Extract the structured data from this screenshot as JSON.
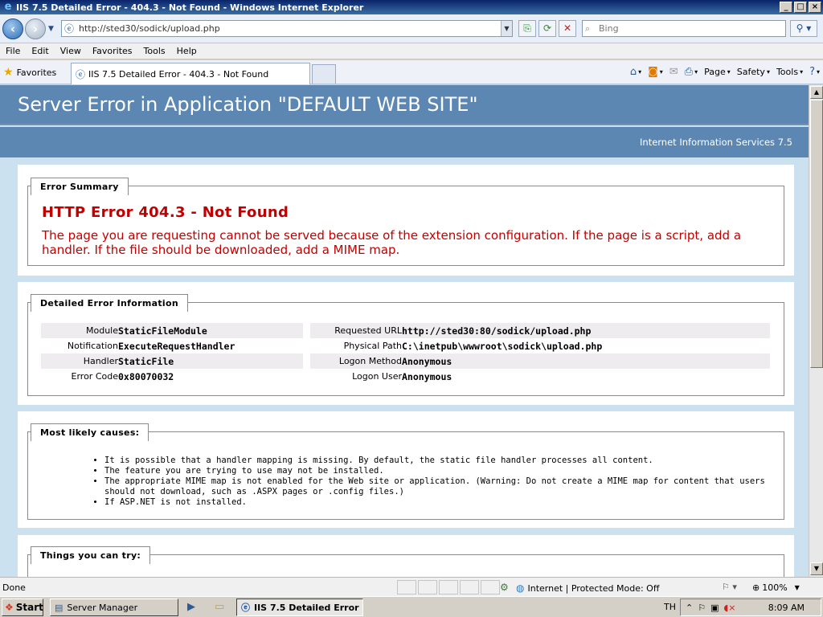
{
  "window": {
    "title": "IIS 7.5 Detailed Error - 404.3 - Not Found - Windows Internet Explorer"
  },
  "address": {
    "url": "http://sted30/sodick/upload.php",
    "search_placeholder": "Bing"
  },
  "menu": [
    "File",
    "Edit",
    "View",
    "Favorites",
    "Tools",
    "Help"
  ],
  "favorites": {
    "label": "Favorites",
    "tab_title": "IIS 7.5 Detailed Error - 404.3 - Not Found",
    "commands": {
      "page": "Page",
      "safety": "Safety",
      "tools": "Tools"
    }
  },
  "page": {
    "header_title": "Server Error in Application \"DEFAULT WEB SITE\"",
    "server_name": "Internet Information Services 7.5",
    "summary": {
      "legend": "Error Summary",
      "title": "HTTP Error 404.3 - Not Found",
      "description": "The page you are requesting cannot be served because of the extension configuration. If the page is a script, add a handler. If the file should be downloaded, add a MIME map."
    },
    "detail": {
      "legend": "Detailed Error Information",
      "left": [
        {
          "label": "Module",
          "value": "StaticFileModule"
        },
        {
          "label": "Notification",
          "value": "ExecuteRequestHandler"
        },
        {
          "label": "Handler",
          "value": "StaticFile"
        },
        {
          "label": "Error Code",
          "value": "0x80070032"
        }
      ],
      "right": [
        {
          "label": "Requested URL",
          "value": "http://sted30:80/sodick/upload.php"
        },
        {
          "label": "Physical Path",
          "value": "C:\\inetpub\\wwwroot\\sodick\\upload.php"
        },
        {
          "label": "Logon Method",
          "value": "Anonymous"
        },
        {
          "label": "Logon User",
          "value": "Anonymous"
        }
      ]
    },
    "causes": {
      "legend": "Most likely causes:",
      "items": [
        "It is possible that a handler mapping is missing. By default, the static file handler processes all content.",
        "The feature you are trying to use may not be installed.",
        "The appropriate MIME map is not enabled for the Web site or application. (Warning: Do not create a MIME map for content that users should not download, such as .ASPX pages or .config files.)",
        "If ASP.NET is not installed."
      ]
    },
    "try": {
      "legend": "Things you can try:"
    }
  },
  "status": {
    "done": "Done",
    "zone": "Internet | Protected Mode: Off",
    "zoom": "100%"
  },
  "taskbar": {
    "start": "Start",
    "tasks": [
      "Server Manager",
      "IIS 7.5 Detailed Error ..."
    ],
    "lang": "TH",
    "clock": "8:09 AM"
  }
}
